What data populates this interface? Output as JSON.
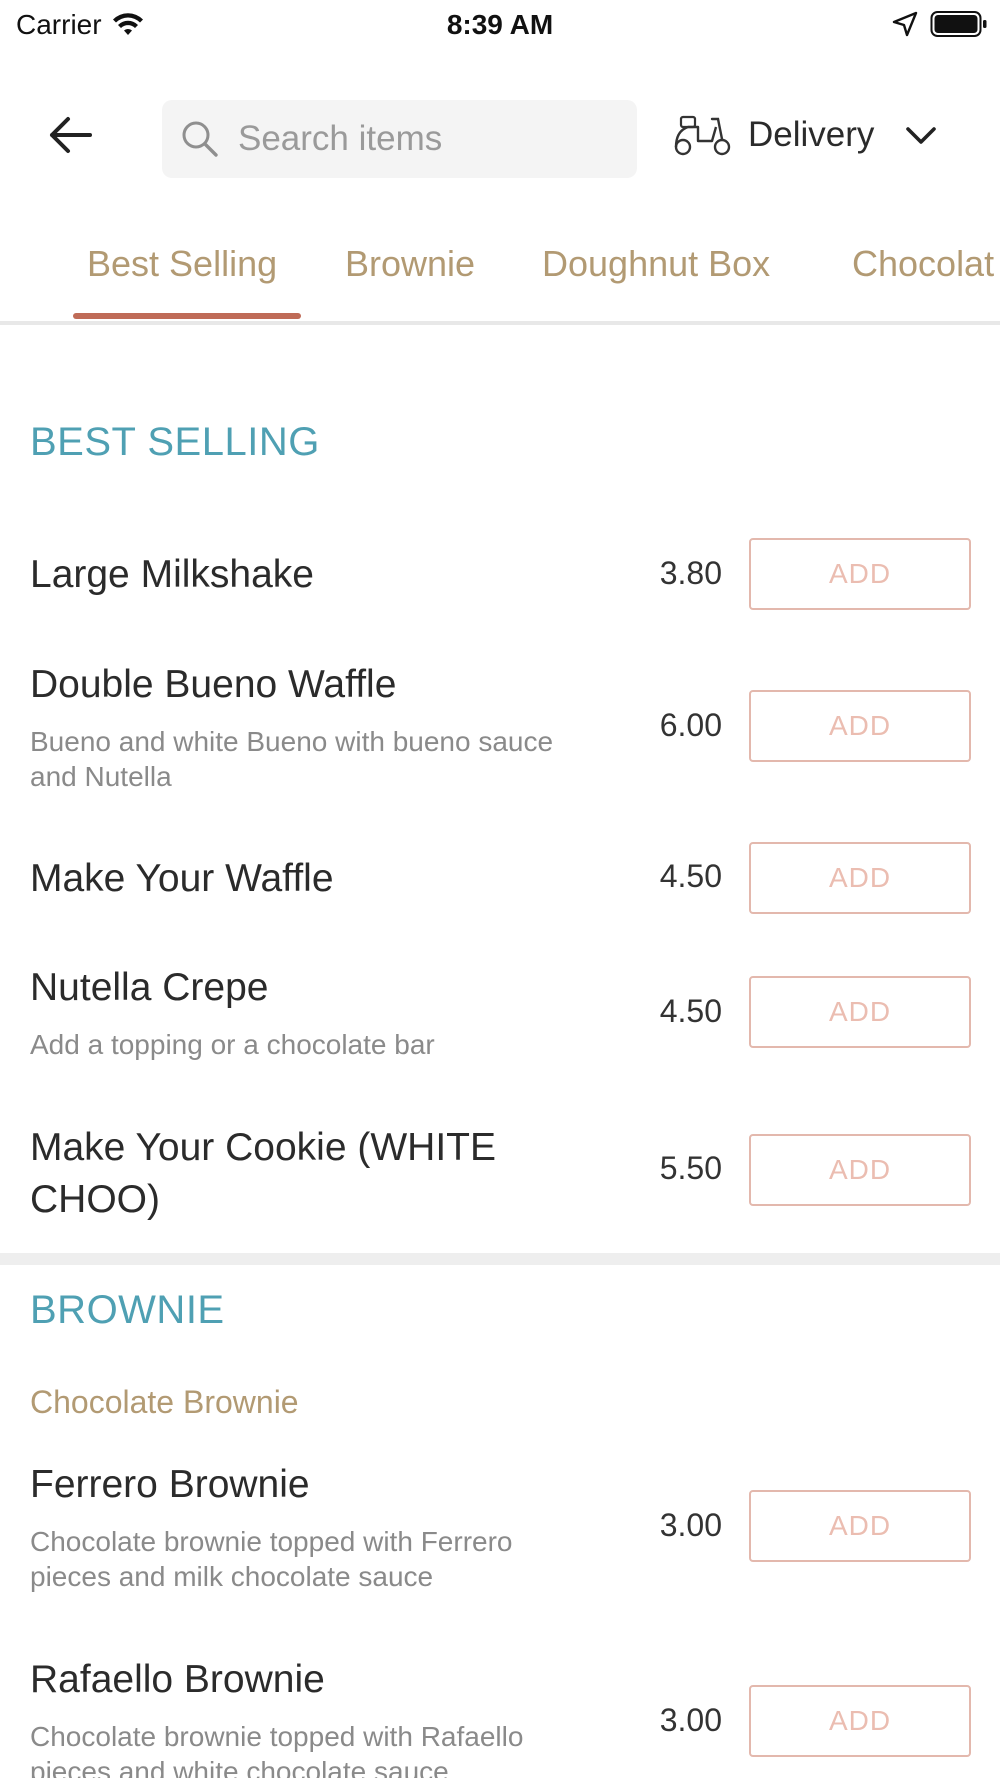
{
  "status_bar": {
    "carrier": "Carrier",
    "time": "8:39 AM"
  },
  "header": {
    "search_placeholder": "Search items",
    "delivery_label": "Delivery"
  },
  "tabs": [
    {
      "label": "Best Selling",
      "active": true
    },
    {
      "label": "Brownie",
      "active": false
    },
    {
      "label": "Doughnut Box",
      "active": false
    },
    {
      "label": "Chocolat",
      "active": false
    }
  ],
  "add_label": "ADD",
  "sections": [
    {
      "title": "BEST SELLING",
      "items": [
        {
          "name": "Large Milkshake",
          "description": "",
          "price": "3.80"
        },
        {
          "name": "Double Bueno Waffle",
          "description": "Bueno and white Bueno with bueno sauce and Nutella",
          "price": "6.00"
        },
        {
          "name": "Make Your Waffle",
          "description": "",
          "price": "4.50"
        },
        {
          "name": "Nutella Crepe",
          "description": "Add a topping or a chocolate bar",
          "price": "4.50"
        },
        {
          "name": "Make Your Cookie (WHITE CHOO)",
          "description": "",
          "price": "5.50"
        }
      ]
    },
    {
      "title": "BROWNIE",
      "subtitle": "Chocolate Brownie",
      "items": [
        {
          "name": "Ferrero Brownie",
          "description": "Chocolate brownie topped with Ferrero pieces and milk chocolate sauce",
          "price": "3.00"
        },
        {
          "name": "Rafaello Brownie",
          "description": "Chocolate brownie topped with Rafaello pieces and white chocolate sauce",
          "price": "3.00"
        }
      ]
    }
  ],
  "colors": {
    "section_title": "#4fa0b3",
    "tab_text": "#b29a73",
    "tab_underline": "#bf6b57",
    "add_border": "#e3b8ad",
    "add_text": "#ebbdb1"
  }
}
